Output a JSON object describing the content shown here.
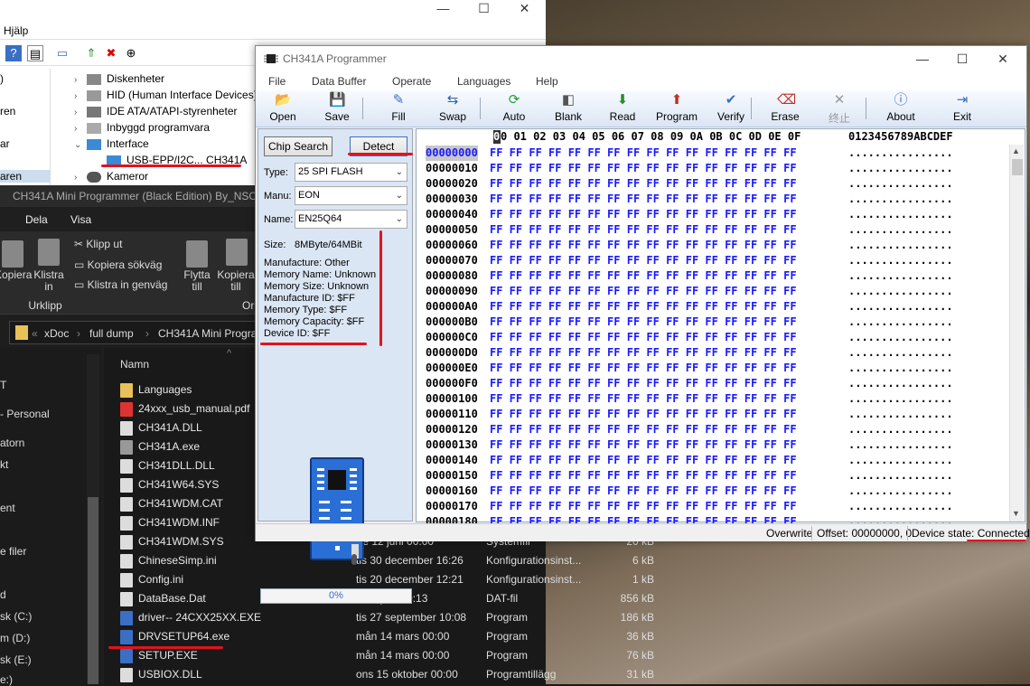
{
  "device_manager": {
    "menu_help": "Hjälp",
    "left_snippets": [
      ")",
      "ren",
      "ar",
      "aren"
    ],
    "tree": [
      {
        "label": "Diskenheter",
        "indent": 1,
        "arrow": "›"
      },
      {
        "label": "HID (Human Interface Devices)",
        "indent": 1,
        "arrow": "›"
      },
      {
        "label": "IDE ATA/ATAPI-styrenheter",
        "indent": 1,
        "arrow": "›"
      },
      {
        "label": "Inbyggd programvara",
        "indent": 1,
        "arrow": "›"
      },
      {
        "label": "Interface",
        "indent": 1,
        "arrow": "⌄"
      },
      {
        "label": "USB-EPP/I2C... CH341A",
        "indent": 2,
        "arrow": ""
      },
      {
        "label": "Kameror",
        "indent": 1,
        "arrow": "›"
      }
    ]
  },
  "explorer": {
    "title": "CH341A Mini Programmer (Black Edition) By_NSC",
    "tabs": [
      "Dela",
      "Visa"
    ],
    "ribbon": {
      "kopiera": "Kopiera",
      "klistra_in": "Klistra in",
      "klipp_ut": "Klipp ut",
      "kopiera_sokvag": "Kopiera sökväg",
      "klistra_genvag": "Klistra in genväg",
      "group_urklipp": "Urklipp",
      "flytta_till": "Flytta till",
      "kopiera_till": "Kopiera till",
      "group_or": "Or"
    },
    "address": [
      "xDoc",
      "full dump",
      "CH341A Mini Progra"
    ],
    "nav_items": [
      "T",
      "- Personal",
      "atorn",
      "kt",
      "ent",
      "e filer",
      "d",
      "sk (C:)",
      "m (D:)",
      "sk (E:)",
      "e:)"
    ],
    "column_name": "Namn",
    "files": [
      {
        "name": "Languages",
        "date": "",
        "type": "",
        "size": "",
        "color": "#e8c15a"
      },
      {
        "name": "24xxx_usb_manual.pdf",
        "date": "",
        "type": "",
        "size": "",
        "color": "#d33"
      },
      {
        "name": "CH341A.DLL",
        "date": "",
        "type": "",
        "size": "",
        "color": "#ddd"
      },
      {
        "name": "CH341A.exe",
        "date": "",
        "type": "",
        "size": "",
        "color": "#999"
      },
      {
        "name": "CH341DLL.DLL",
        "date": "",
        "type": "",
        "size": "",
        "color": "#ddd"
      },
      {
        "name": "CH341W64.SYS",
        "date": "",
        "type": "",
        "size": "",
        "color": "#ddd"
      },
      {
        "name": "CH341WDM.CAT",
        "date": "",
        "type": "",
        "size": "",
        "color": "#ddd"
      },
      {
        "name": "CH341WDM.INF",
        "date": "",
        "type": "",
        "size": "",
        "color": "#ddd"
      },
      {
        "name": "CH341WDM.SYS",
        "date": "fre 12 juni 00:00",
        "type": "Systemfil",
        "size": "20 kB",
        "color": "#ddd"
      },
      {
        "name": "ChineseSimp.ini",
        "date": "tis 30 december 16:26",
        "type": "Konfigurationsinst...",
        "size": "6 kB",
        "color": "#ddd"
      },
      {
        "name": "Config.ini",
        "date": "tis 20 december 12:21",
        "type": "Konfigurationsinst...",
        "size": "1 kB",
        "color": "#ddd"
      },
      {
        "name": "DataBase.Dat",
        "date": "fre 1 juni 20:13",
        "type": "DAT-fil",
        "size": "856 kB",
        "color": "#ddd"
      },
      {
        "name": "driver-- 24CXX25XX.EXE",
        "date": "tis 27 september 10:08",
        "type": "Program",
        "size": "186 kB",
        "color": "#3a6fc4"
      },
      {
        "name": "DRVSETUP64.exe",
        "date": "mån 14 mars 00:00",
        "type": "Program",
        "size": "36 kB",
        "color": "#3a6fc4"
      },
      {
        "name": "SETUP.EXE",
        "date": "mån 14 mars 00:00",
        "type": "Program",
        "size": "76 kB",
        "color": "#3a6fc4"
      },
      {
        "name": "USBIOX.DLL",
        "date": "ons 15 oktober 00:00",
        "type": "Programtillägg",
        "size": "31 kB",
        "color": "#ddd"
      }
    ]
  },
  "programmer": {
    "title": "CH341A Programmer",
    "menu": [
      "File",
      "Data Buffer",
      "Operate",
      "Languages",
      "Help"
    ],
    "toolbar": [
      {
        "label": "Open",
        "icon": "folder-open-icon",
        "glyph": "📂"
      },
      {
        "label": "Save",
        "icon": "save-icon",
        "glyph": "💾"
      },
      {
        "label": "Fill",
        "icon": "fill-icon",
        "glyph": "✎"
      },
      {
        "label": "Swap",
        "icon": "swap-icon",
        "glyph": "⇆"
      },
      {
        "label": "Auto",
        "icon": "auto-icon",
        "glyph": "⟳"
      },
      {
        "label": "Blank",
        "icon": "blank-icon",
        "glyph": "◧"
      },
      {
        "label": "Read",
        "icon": "read-icon",
        "glyph": "⬇"
      },
      {
        "label": "Program",
        "icon": "program-icon",
        "glyph": "⬆"
      },
      {
        "label": "Verify",
        "icon": "verify-icon",
        "glyph": "✔"
      },
      {
        "label": "Erase",
        "icon": "erase-icon",
        "glyph": "⌫"
      },
      {
        "label": "终止",
        "icon": "stop-icon",
        "glyph": "✕"
      },
      {
        "label": "About",
        "icon": "about-icon",
        "glyph": "ⓘ"
      },
      {
        "label": "Exit",
        "icon": "exit-icon",
        "glyph": "⇥"
      }
    ],
    "chip_search": "Chip Search",
    "detect": "Detect",
    "type_label": "Type:",
    "type_value": "25 SPI FLASH",
    "manu_label": "Manu:",
    "manu_value": "EON",
    "name_label": "Name:",
    "name_value": "EN25Q64",
    "size_label": "Size:",
    "size_value": "8MByte/64MBit",
    "info": [
      "Manufacture: Other",
      "Memory Name: Unknown",
      "Memory Size: Unknown",
      "Manufacture ID: $FF",
      "Memory Type: $FF",
      "Memory Capacity: $FF",
      "Device ID: $FF"
    ],
    "progress": "0%",
    "hex_header": "0 01 02 03 04 05 06 07 08 09 0A 0B 0C 0D 0E 0F",
    "hex_ascii_header": "0123456789ABCDEF",
    "hex_cursor": "0",
    "hex_rows": [
      "00000000",
      "00000010",
      "00000020",
      "00000030",
      "00000040",
      "00000050",
      "00000060",
      "00000070",
      "00000080",
      "00000090",
      "000000A0",
      "000000B0",
      "000000C0",
      "000000D0",
      "000000E0",
      "000000F0",
      "00000100",
      "00000110",
      "00000120",
      "00000130",
      "00000140",
      "00000150",
      "00000160",
      "00000170",
      "00000180"
    ],
    "hex_bytes": "FF FF FF FF FF FF FF FF FF FF FF FF FF FF FF FF",
    "hex_ascii": "................",
    "status": {
      "mode": "Overwrite",
      "offset": "Offset: 00000000, 0",
      "device_state": "Device state: Connected."
    }
  }
}
